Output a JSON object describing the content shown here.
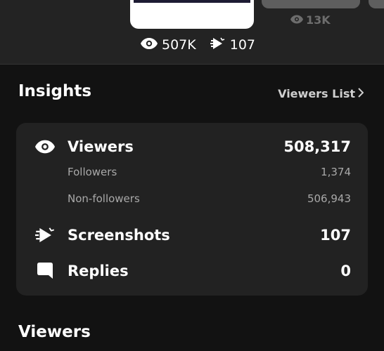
{
  "top": {
    "side_post": {
      "views": "13K",
      "icon": "eye-icon"
    },
    "current_post": {
      "views": "507K",
      "screenshots": "107",
      "view_icon": "eye-icon",
      "screenshot_icon": "screenshot-icon"
    }
  },
  "insights": {
    "title": "Insights",
    "viewers_list_label": "Viewers List",
    "metrics": {
      "viewers": {
        "label": "Viewers",
        "value": "508,317",
        "icon": "eye-icon"
      },
      "followers": {
        "label": "Followers",
        "value": "1,374"
      },
      "non_followers": {
        "label": "Non-followers",
        "value": "506,943"
      },
      "screenshots": {
        "label": "Screenshots",
        "value": "107",
        "icon": "screenshot-icon"
      },
      "replies": {
        "label": "Replies",
        "value": "0",
        "icon": "reply-bubble-icon"
      }
    }
  },
  "viewers_section": {
    "title": "Viewers"
  },
  "colors": {
    "background": "#121212",
    "top_bar": "#232323",
    "card": "#222222",
    "secondary_text": "#a9a9a9"
  }
}
